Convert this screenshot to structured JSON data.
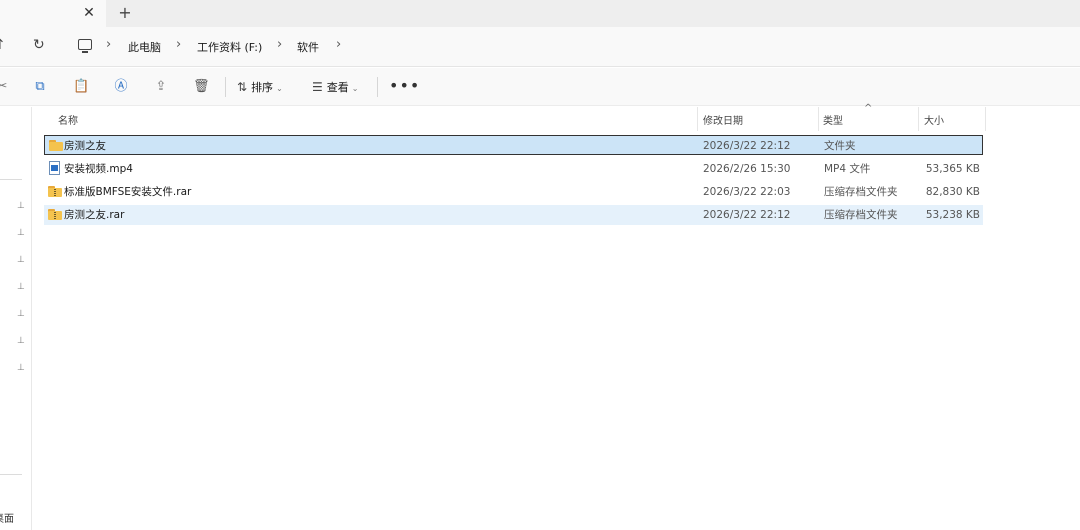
{
  "titlebar": {
    "close_glyph": "✕",
    "new_tab_glyph": "+"
  },
  "navbar": {
    "up_glyph": "↑",
    "refresh_glyph": "↻",
    "separator": "›",
    "breadcrumbs": [
      "此电脑",
      "工作资料 (F:)",
      "软件"
    ]
  },
  "toolbar": {
    "sort_label": "排序",
    "view_label": "查看",
    "more_glyph": "•••",
    "chevron": "⌄",
    "icons": [
      "cut-icon",
      "copy-icon",
      "paste-icon",
      "rename-icon",
      "share-icon",
      "delete-icon"
    ]
  },
  "columns": {
    "name": "名称",
    "modified": "修改日期",
    "type": "类型",
    "size": "大小",
    "sort_caret": "^"
  },
  "files": [
    {
      "name": "房测之友",
      "modified": "2026/3/22 22:12",
      "type": "文件夹",
      "size": "",
      "icon": "folder-icon",
      "state": "selected"
    },
    {
      "name": "安装视频.mp4",
      "modified": "2026/2/26 15:30",
      "type": "MP4 文件",
      "size": "53,365 KB",
      "icon": "video-file-icon",
      "state": "normal"
    },
    {
      "name": "标准版BMFSE安装文件.rar",
      "modified": "2026/3/22 22:03",
      "type": "压缩存档文件夹",
      "size": "82,830 KB",
      "icon": "zip-folder-icon",
      "state": "normal"
    },
    {
      "name": "房测之友.rar",
      "modified": "2026/3/22 22:12",
      "type": "压缩存档文件夹",
      "size": "53,238 KB",
      "icon": "zip-folder-icon",
      "state": "hover"
    }
  ],
  "sidebar": {
    "bottom_text": "桌面",
    "pin_glyph": "📌"
  }
}
